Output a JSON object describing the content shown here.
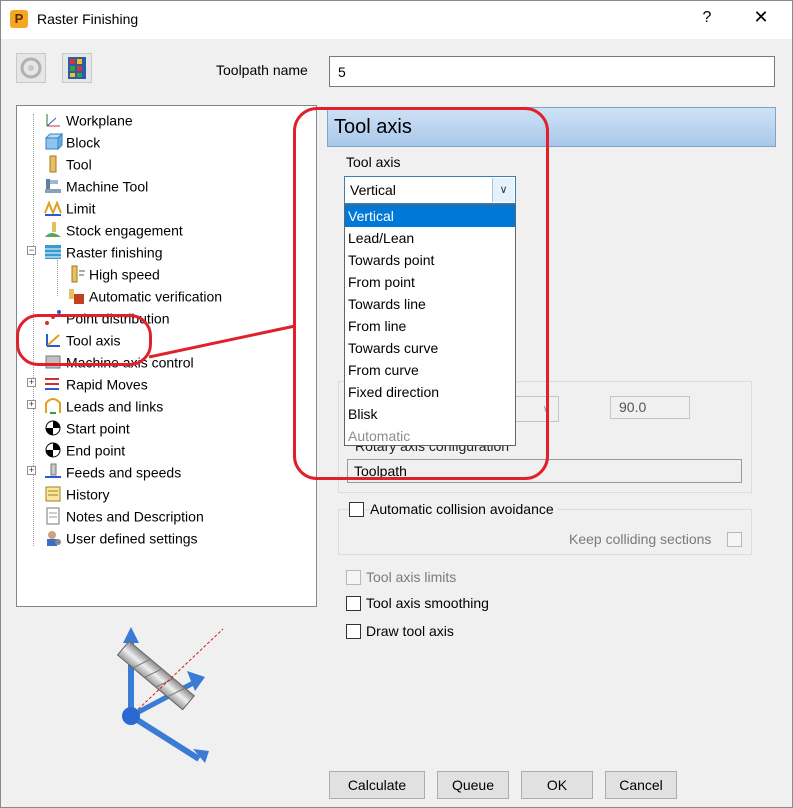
{
  "window": {
    "title": "Raster Finishing",
    "help_symbol": "?",
    "close_symbol": "✕"
  },
  "toolbar": {
    "icons": [
      "settings-disabled-icon",
      "palette-icon"
    ]
  },
  "toolpath": {
    "label": "Toolpath name",
    "value": "5"
  },
  "tree": {
    "items": [
      {
        "label": "Workplane",
        "icon": "workplane-icon"
      },
      {
        "label": "Block",
        "icon": "block-icon"
      },
      {
        "label": "Tool",
        "icon": "tool-icon"
      },
      {
        "label": "Machine Tool",
        "icon": "machine-tool-icon"
      },
      {
        "label": "Limit",
        "icon": "limit-icon"
      },
      {
        "label": "Stock engagement",
        "icon": "stock-engagement-icon"
      },
      {
        "label": "Raster finishing",
        "icon": "raster-finishing-icon"
      },
      {
        "label": "High speed",
        "icon": "high-speed-icon"
      },
      {
        "label": "Automatic verification",
        "icon": "automatic-verification-icon"
      },
      {
        "label": "Point distribution",
        "icon": "point-distribution-icon"
      },
      {
        "label": "Tool axis",
        "icon": "tool-axis-icon"
      },
      {
        "label": "Machine axis control",
        "icon": "machine-axis-control-icon"
      },
      {
        "label": "Rapid Moves",
        "icon": "rapid-moves-icon"
      },
      {
        "label": "Leads and links",
        "icon": "leads-links-icon"
      },
      {
        "label": "Start point",
        "icon": "start-point-icon"
      },
      {
        "label": "End point",
        "icon": "end-point-icon"
      },
      {
        "label": "Feeds and speeds",
        "icon": "feeds-speeds-icon"
      },
      {
        "label": "History",
        "icon": "history-icon"
      },
      {
        "label": "Notes and Description",
        "icon": "notes-icon"
      },
      {
        "label": "User defined settings",
        "icon": "user-settings-icon"
      }
    ]
  },
  "panel": {
    "header": "Tool axis",
    "tool_axis_label": "Tool axis",
    "selected_value": "Vertical",
    "options": [
      {
        "label": "Vertical",
        "state": "selected"
      },
      {
        "label": "Lead/Lean",
        "state": "normal"
      },
      {
        "label": "Towards point",
        "state": "normal"
      },
      {
        "label": "From point",
        "state": "normal"
      },
      {
        "label": "Towards line",
        "state": "normal"
      },
      {
        "label": "From line",
        "state": "normal"
      },
      {
        "label": "Towards curve",
        "state": "normal"
      },
      {
        "label": "From curve",
        "state": "normal"
      },
      {
        "label": "Fixed direction",
        "state": "normal"
      },
      {
        "label": "Blisk",
        "state": "normal"
      },
      {
        "label": "Automatic",
        "state": "disabled"
      }
    ],
    "angle_value": "90.0",
    "rotary_label": "Rotary axis configuration",
    "rotary_value": "Toolpath",
    "auto_collision_label": "Automatic collision avoidance",
    "keep_colliding_label": "Keep colliding sections",
    "tool_axis_limits_label": "Tool axis limits",
    "tool_axis_smoothing_label": "Tool axis smoothing",
    "draw_tool_axis_label": "Draw tool axis"
  },
  "buttons": {
    "calculate": "Calculate",
    "queue": "Queue",
    "ok": "OK",
    "cancel": "Cancel"
  },
  "colors": {
    "annotation": "#e0202a",
    "selection": "#0078d7",
    "header_blue": "#a8c8ea"
  }
}
